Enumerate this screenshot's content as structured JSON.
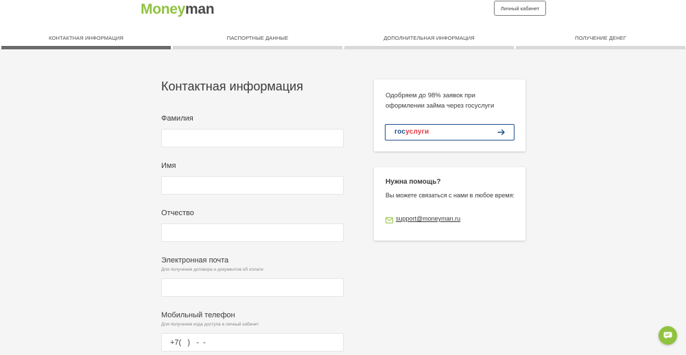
{
  "header": {
    "logo_part1": "Money",
    "logo_part2": "man",
    "cabinet_label": "Личный кабинет"
  },
  "steps": [
    {
      "label": "КОНТАКТНАЯ ИНФОРМАЦИЯ",
      "active": true
    },
    {
      "label": "ПАСПОРТНЫЕ ДАННЫЕ",
      "active": false
    },
    {
      "label": "ДОПОЛНИТЕЛЬНАЯ ИНФОРМАЦИЯ",
      "active": false
    },
    {
      "label": "ПОЛУЧЕНИЕ ДЕНЕГ",
      "active": false
    }
  ],
  "form": {
    "title": "Контактная информация",
    "surname": {
      "label": "Фамилия",
      "value": ""
    },
    "name": {
      "label": "Имя",
      "value": ""
    },
    "patronymic": {
      "label": "Отчество",
      "value": ""
    },
    "email": {
      "label": "Электронная почта",
      "hint": "Для получения договора и документов об оплате",
      "value": ""
    },
    "phone": {
      "label": "Мобильный телефон",
      "hint": "Для получения кода доступа в личный кабинет",
      "value": "+7(   )   -  -"
    }
  },
  "gosuslugi_card": {
    "text_line1": "Одобряем до 98% заявок при",
    "text_line2": "оформлении займа через госуслуги",
    "logo_part1": "гос",
    "logo_part2": "услуги"
  },
  "help_card": {
    "title": "Нужна помощь?",
    "text": "Вы можете связаться с нами в любое время:",
    "email": "support@moneyman.ru"
  },
  "colors": {
    "brand_green": "#8fc33e",
    "gos_blue": "#1d4f86",
    "gos_red": "#e3373f",
    "active_step": "#6b6b6b",
    "inactive_step": "#d9d9d9"
  }
}
